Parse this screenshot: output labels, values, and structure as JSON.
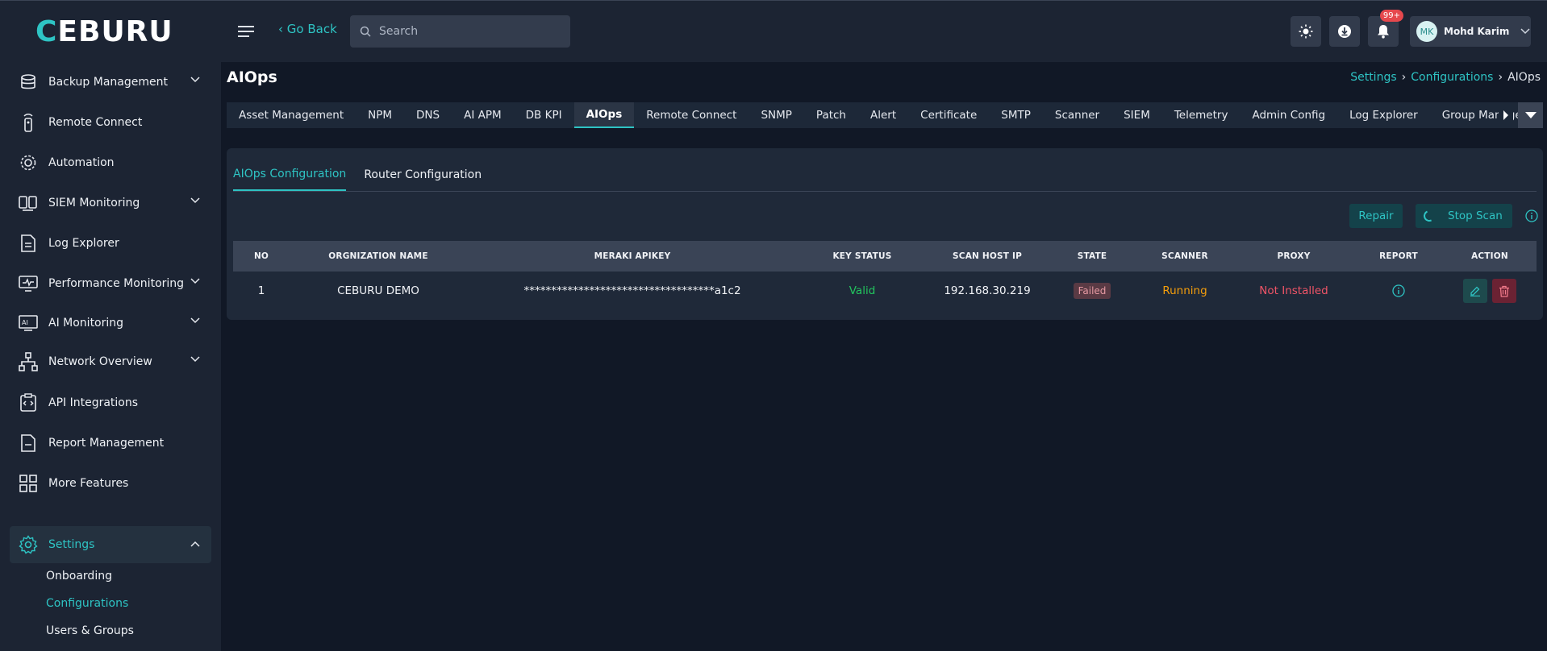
{
  "brand": {
    "logo_text": "CEBURU",
    "accent": "#2ec4c4"
  },
  "header": {
    "go_back_label": "Go Back",
    "search_placeholder": "Search",
    "notification_count": "99+",
    "user": {
      "initials": "MK",
      "name": "Mohd Karim"
    }
  },
  "sidebar": {
    "items": [
      {
        "label": "Backup Management",
        "icon": "database-icon"
      },
      {
        "label": "Remote Connect",
        "icon": "remote-icon"
      },
      {
        "label": "Automation",
        "icon": "gear-automation-icon"
      },
      {
        "label": "SIEM Monitoring",
        "icon": "siem-icon"
      },
      {
        "label": "Log Explorer",
        "icon": "document-icon"
      },
      {
        "label": "Performance Monitoring",
        "icon": "monitor-icon"
      },
      {
        "label": "AI Monitoring",
        "icon": "ai-icon"
      },
      {
        "label": "Network Overview",
        "icon": "network-icon"
      },
      {
        "label": "API Integrations",
        "icon": "api-icon"
      },
      {
        "label": "Report Management",
        "icon": "report-icon"
      },
      {
        "label": "More Features",
        "icon": "grid-icon"
      },
      {
        "label": "Settings",
        "icon": "settings-icon"
      }
    ],
    "settings_sub": [
      "Onboarding",
      "Configurations",
      "Users & Groups"
    ]
  },
  "page": {
    "title": "AIOps",
    "breadcrumb": [
      "Settings",
      "Configurations",
      "AIOps"
    ]
  },
  "tabs": [
    "Asset Management",
    "NPM",
    "DNS",
    "AI APM",
    "DB KPI",
    "AIOps",
    "Remote Connect",
    "SNMP",
    "Patch",
    "Alert",
    "Certificate",
    "SMTP",
    "Scanner",
    "SIEM",
    "Telemetry",
    "Admin Config",
    "Log Explorer",
    "Group Manage"
  ],
  "subtabs": [
    "AIOps Configuration",
    "Router Configuration"
  ],
  "actions": {
    "repair": "Repair",
    "stop_scan": "Stop Scan"
  },
  "table": {
    "headers": [
      "NO",
      "ORGNIZATION NAME",
      "MERAKI APIKEY",
      "KEY STATUS",
      "SCAN HOST IP",
      "STATE",
      "SCANNER",
      "PROXY",
      "REPORT",
      "ACTION"
    ],
    "rows": [
      {
        "no": "1",
        "org": "CEBURU DEMO",
        "apikey": "***********************************a1c2",
        "key_status": "Valid",
        "host_ip": "192.168.30.219",
        "state": "Failed",
        "scanner": "Running",
        "proxy": "Not Installed"
      }
    ]
  },
  "colors": {
    "valid": "#22c55e",
    "running": "#f59e0b",
    "not_installed": "#f05467"
  }
}
